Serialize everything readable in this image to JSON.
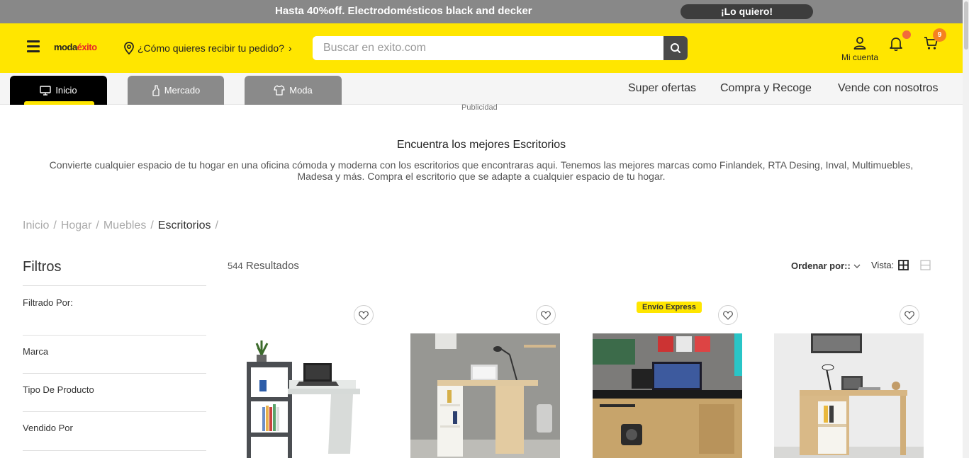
{
  "promo": {
    "text": "Hasta 40%off. Electrodomésticos black and decker",
    "cta": "¡Lo quiero!"
  },
  "header": {
    "logo_main": "moda",
    "logo_brand": "éxito",
    "delivery_text": "¿Cómo quieres recibir tu pedido?",
    "search_placeholder": "Buscar en exito.com",
    "account_label": "Mi cuenta",
    "cart_count": "9"
  },
  "nav": {
    "tabs": [
      {
        "label": "Inicio",
        "icon": "monitor-icon",
        "active": true
      },
      {
        "label": "Mercado",
        "icon": "bottle-icon",
        "active": false
      },
      {
        "label": "Moda",
        "icon": "shirt-icon",
        "active": false
      }
    ],
    "links": [
      "Super ofertas",
      "Compra y Recoge",
      "Vende con nosotros"
    ]
  },
  "ad_label": "Publicidad",
  "intro": {
    "title": "Encuentra los mejores Escritorios",
    "description": "Convierte cualquier espacio de tu hogar en una oficina cómoda y moderna con los escritorios que encontraras aqui. Tenemos las mejores marcas como Finlandek, RTA Desing, Inval, Multimuebles, Madesa y más. Compra el escritorio que se adapte a cualquier espacio de tu hogar."
  },
  "breadcrumb": {
    "items": [
      "Inicio",
      "Hogar",
      "Muebles"
    ],
    "current": "Escritorios",
    "separator": "/"
  },
  "filters": {
    "title": "Filtros",
    "filtered_by": "Filtrado Por:",
    "items": [
      "Marca",
      "Tipo De Producto",
      "Vendido Por"
    ]
  },
  "results": {
    "count": "544",
    "label": "Resultados",
    "sort_label": "Ordenar por::",
    "view_label": "Vista:"
  },
  "products": [
    {
      "badge": "",
      "image": "desk-gray-shelf"
    },
    {
      "badge": "",
      "image": "desk-white-wood-room"
    },
    {
      "badge": "Envío Express",
      "image": "desk-gaming-wood"
    },
    {
      "badge": "",
      "image": "desk-wood-white-shelf"
    }
  ],
  "colors": {
    "brand_yellow": "#ffe600",
    "promo_gray": "#888888",
    "cart_orange": "#f58220"
  }
}
